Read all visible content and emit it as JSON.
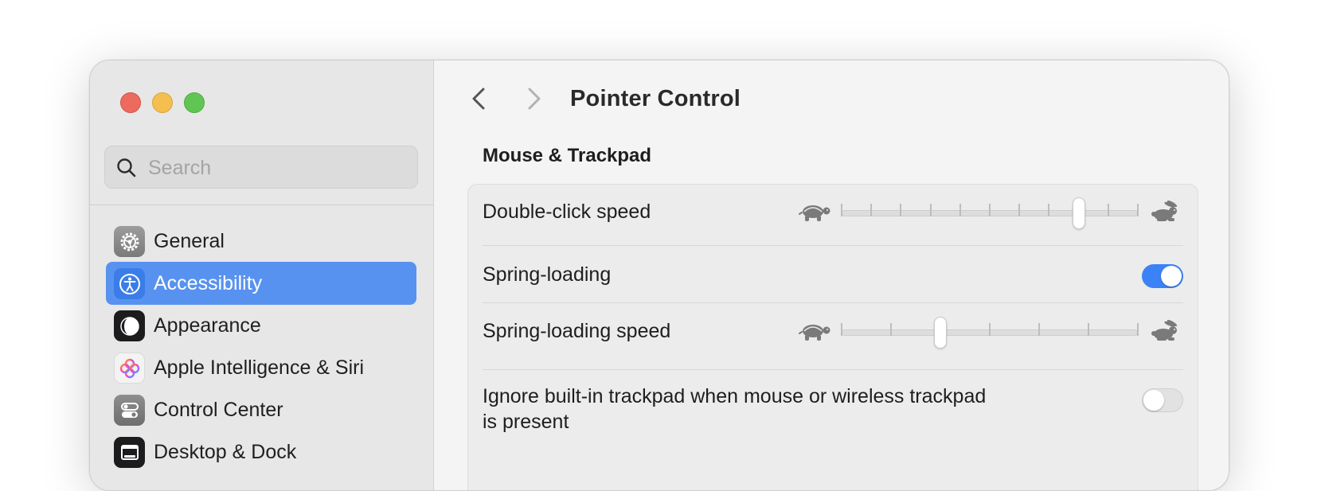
{
  "window": {
    "controls": [
      "close",
      "minimize",
      "zoom"
    ]
  },
  "sidebar": {
    "search": {
      "placeholder": "Search",
      "value": ""
    },
    "items": [
      {
        "label": "General",
        "icon": "gear-icon",
        "selected": false
      },
      {
        "label": "Accessibility",
        "icon": "accessibility-icon",
        "selected": true
      },
      {
        "label": "Appearance",
        "icon": "appearance-icon",
        "selected": false
      },
      {
        "label": "Apple Intelligence & Siri",
        "icon": "apple-intelligence-icon",
        "selected": false
      },
      {
        "label": "Control Center",
        "icon": "control-center-icon",
        "selected": false
      },
      {
        "label": "Desktop & Dock",
        "icon": "desktop-dock-icon",
        "selected": false
      }
    ]
  },
  "main": {
    "title": "Pointer Control",
    "section_title": "Mouse & Trackpad",
    "rows": {
      "double_click_speed": {
        "label": "Double-click speed",
        "value_step": 8,
        "steps": 10
      },
      "spring_loading": {
        "label": "Spring-loading",
        "on": true
      },
      "spring_loading_speed": {
        "label": "Spring-loading speed",
        "value_step": 2,
        "steps": 6
      },
      "ignore_trackpad": {
        "label_line1": "Ignore built-in trackpad when mouse or wireless trackpad",
        "label_line2": "is present",
        "on": false
      }
    }
  },
  "colors": {
    "accent": "#3b82f6",
    "sidebar_selected": "#5892f0"
  }
}
